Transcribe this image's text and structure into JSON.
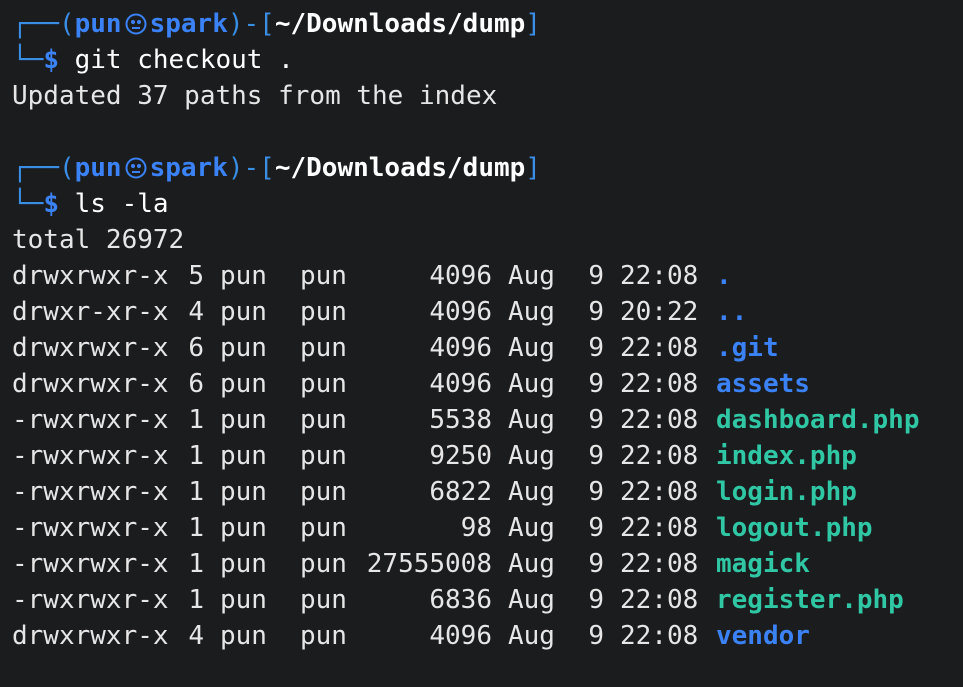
{
  "prompts": [
    {
      "frame_open": "┌──(",
      "user": "pun",
      "host": "spark",
      "frame_mid": ")-[",
      "cwd": "~/Downloads/dump",
      "frame_close": "]",
      "frame_bottom": "└─",
      "dollar": "$",
      "command": "git checkout ."
    },
    {
      "frame_open": "┌──(",
      "user": "pun",
      "host": "spark",
      "frame_mid": ")-[",
      "cwd": "~/Downloads/dump",
      "frame_close": "]",
      "frame_bottom": "└─",
      "dollar": "$",
      "command": "ls -la"
    }
  ],
  "git_output": "Updated 37 paths from the index",
  "total_line": "total 26972",
  "listing": [
    {
      "perm": "drwxrwxr-x",
      "links": "5",
      "owner": "pun",
      "group": "pun",
      "size": "4096",
      "month": "Aug",
      "day": "9",
      "time": "22:08",
      "name": ".",
      "type": "dir"
    },
    {
      "perm": "drwxr-xr-x",
      "links": "4",
      "owner": "pun",
      "group": "pun",
      "size": "4096",
      "month": "Aug",
      "day": "9",
      "time": "20:22",
      "name": "..",
      "type": "dir"
    },
    {
      "perm": "drwxrwxr-x",
      "links": "6",
      "owner": "pun",
      "group": "pun",
      "size": "4096",
      "month": "Aug",
      "day": "9",
      "time": "22:08",
      "name": ".git",
      "type": "dir"
    },
    {
      "perm": "drwxrwxr-x",
      "links": "6",
      "owner": "pun",
      "group": "pun",
      "size": "4096",
      "month": "Aug",
      "day": "9",
      "time": "22:08",
      "name": "assets",
      "type": "dir"
    },
    {
      "perm": "-rwxrwxr-x",
      "links": "1",
      "owner": "pun",
      "group": "pun",
      "size": "5538",
      "month": "Aug",
      "day": "9",
      "time": "22:08",
      "name": "dashboard.php",
      "type": "exe"
    },
    {
      "perm": "-rwxrwxr-x",
      "links": "1",
      "owner": "pun",
      "group": "pun",
      "size": "9250",
      "month": "Aug",
      "day": "9",
      "time": "22:08",
      "name": "index.php",
      "type": "exe"
    },
    {
      "perm": "-rwxrwxr-x",
      "links": "1",
      "owner": "pun",
      "group": "pun",
      "size": "6822",
      "month": "Aug",
      "day": "9",
      "time": "22:08",
      "name": "login.php",
      "type": "exe"
    },
    {
      "perm": "-rwxrwxr-x",
      "links": "1",
      "owner": "pun",
      "group": "pun",
      "size": "98",
      "month": "Aug",
      "day": "9",
      "time": "22:08",
      "name": "logout.php",
      "type": "exe"
    },
    {
      "perm": "-rwxrwxr-x",
      "links": "1",
      "owner": "pun",
      "group": "pun",
      "size": "27555008",
      "month": "Aug",
      "day": "9",
      "time": "22:08",
      "name": "magick",
      "type": "exe"
    },
    {
      "perm": "-rwxrwxr-x",
      "links": "1",
      "owner": "pun",
      "group": "pun",
      "size": "6836",
      "month": "Aug",
      "day": "9",
      "time": "22:08",
      "name": "register.php",
      "type": "exe"
    },
    {
      "perm": "drwxrwxr-x",
      "links": "4",
      "owner": "pun",
      "group": "pun",
      "size": "4096",
      "month": "Aug",
      "day": "9",
      "time": "22:08",
      "name": "vendor",
      "type": "dir"
    }
  ],
  "colors": {
    "background": "#1b1c1e",
    "prompt_blue": "#3b82f6",
    "exec_green": "#2fc7a4",
    "text": "#e6e6e6"
  },
  "icons": {
    "prompt_separator": "skull-icon"
  }
}
